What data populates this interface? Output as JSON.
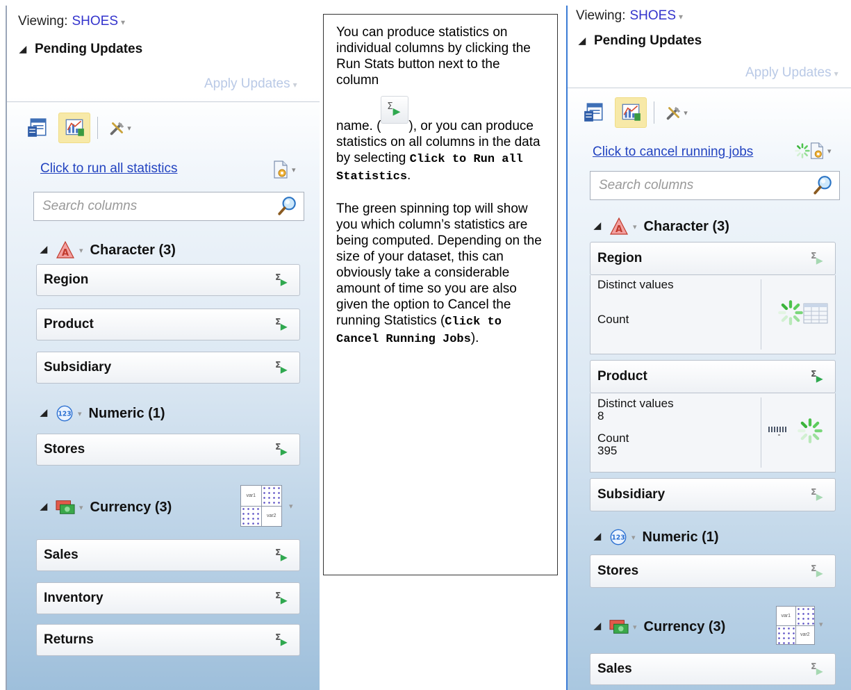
{
  "left_panel": {
    "viewing_label": "Viewing:",
    "dataset": "SHOES",
    "pending_updates": "Pending Updates",
    "apply_updates": "Apply Updates",
    "run_all_link": "Click to run all statistics",
    "search_placeholder": "Search columns",
    "groups": {
      "character": {
        "label": "Character (3)",
        "columns": [
          "Region",
          "Product",
          "Subsidiary"
        ]
      },
      "numeric": {
        "label": "Numeric (1)",
        "columns": [
          "Stores"
        ]
      },
      "currency": {
        "label": "Currency (3)",
        "columns": [
          "Sales",
          "Inventory",
          "Returns"
        ]
      }
    }
  },
  "explanation": {
    "para1_a": "You can produce statistics on individual columns by clicking the Run Stats button next to the column",
    "para1_b": "name. (",
    "para1_c": "), or you can produce statistics on all columns in the data by selecting ",
    "para1_code": "Click to Run all Statistics",
    "para1_end": ".",
    "para2_a": "The green spinning top will show you which column’s statistics are being computed.  Depending on the size of your dataset, this can obviously take a considerable amount of time so you are also given the option to Cancel the running Statistics (",
    "para2_code": "Click to Cancel Running Jobs",
    "para2_end": ")."
  },
  "right_panel": {
    "viewing_label": "Viewing:",
    "dataset": "SHOES",
    "pending_updates": "Pending Updates",
    "apply_updates": "Apply Updates",
    "cancel_link": "Click to cancel running jobs",
    "search_placeholder": "Search columns",
    "groups": {
      "character": {
        "label": "Character (3)"
      },
      "numeric": {
        "label": "Numeric (1)"
      },
      "currency": {
        "label": "Currency (3)"
      }
    },
    "region": {
      "name": "Region",
      "stat1_label": "Distinct values",
      "stat2_label": "Count"
    },
    "product": {
      "name": "Product",
      "stat1_label": "Distinct values",
      "stat1_value": "8",
      "stat2_label": "Count",
      "stat2_value": "395"
    },
    "subsidiary": "Subsidiary",
    "stores": "Stores",
    "sales": "Sales"
  },
  "matrix_labels": {
    "a": "var1",
    "b": "var2"
  },
  "colors": {
    "link": "#2243c0",
    "dataset": "#3333cc",
    "run_stats_green": "#2fa84f",
    "spinner_green": "#4cc24c"
  },
  "icons": [
    "run-stats-icon",
    "search-icon",
    "character-type-icon",
    "numeric-type-icon",
    "currency-type-icon",
    "spinner-icon",
    "new-document-icon",
    "edit-properties-icon",
    "chart-icon",
    "tools-icon",
    "scatter-matrix-icon"
  ]
}
